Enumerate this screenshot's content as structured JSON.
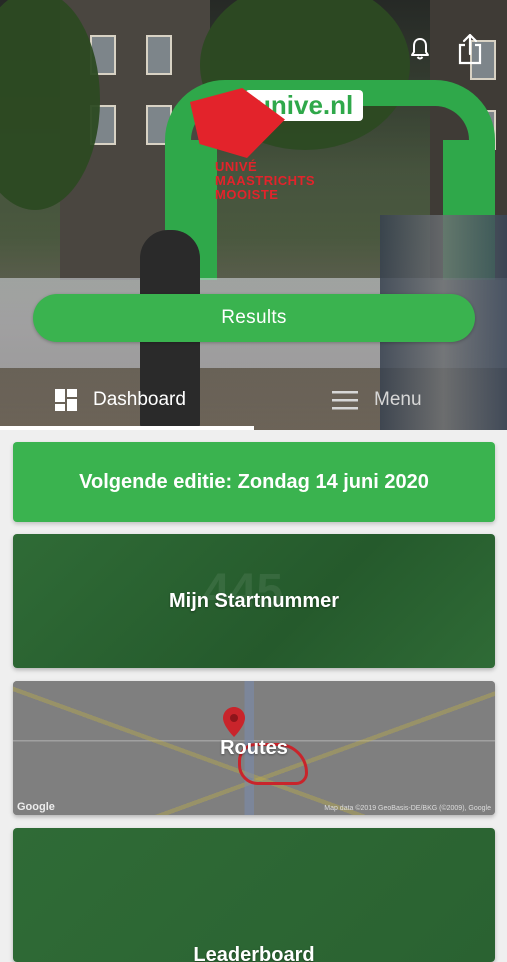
{
  "header": {
    "notification_icon": "bell-icon",
    "share_icon": "share-icon",
    "hero_sign_text": "unive.nl",
    "hero_logo_text": [
      "UNIVÉ",
      "MAASTRICHTS",
      "MOOISTE"
    ],
    "results_label": "Results"
  },
  "tabs": [
    {
      "label": "Dashboard",
      "icon": "dashboard-icon",
      "active": true
    },
    {
      "label": "Menu",
      "icon": "hamburger-icon",
      "active": false
    }
  ],
  "notice": {
    "text": "Volgende editie: Zondag 14 juni 2020"
  },
  "cards": [
    {
      "label": "Mijn Startnummer",
      "bg_number": "445"
    },
    {
      "label": "Routes",
      "map_brand": "Google",
      "map_attribution": "Map data ©2019 GeoBasis-DE/BKG (©2009), Google"
    },
    {
      "label": "Leaderboard"
    }
  ],
  "colors": {
    "accent": "#3ab34f",
    "route": "#c9242b",
    "background": "#efefef"
  }
}
